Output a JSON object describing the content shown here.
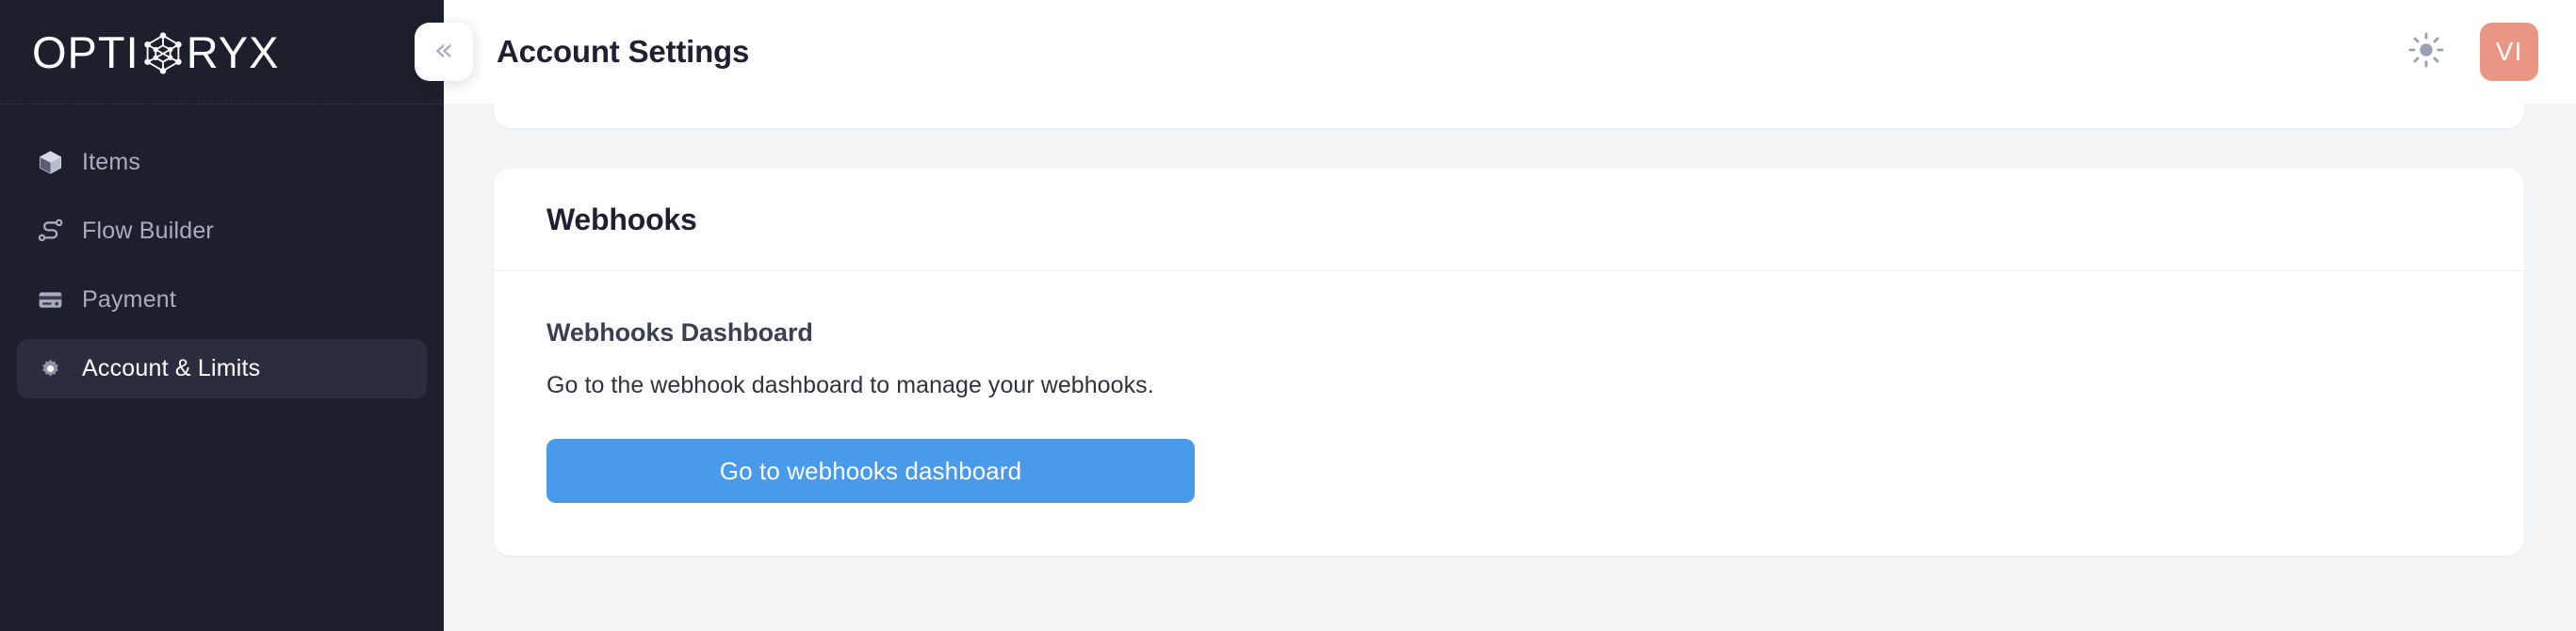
{
  "brand": {
    "text_before": "OPTI",
    "glyph_icon": "network-hexagon-icon",
    "text_after": "RYX",
    "full_name": "OPTIORYX"
  },
  "sidebar": {
    "background_color": "#1e1f2d",
    "active_item_color": "#2b2d3e",
    "items": [
      {
        "label": "Items",
        "icon": "cube-icon",
        "active": false
      },
      {
        "label": "Flow Builder",
        "icon": "workflow-icon",
        "active": false
      },
      {
        "label": "Payment",
        "icon": "credit-card-icon",
        "active": false
      },
      {
        "label": "Account & Limits",
        "icon": "gear-icon",
        "active": true
      }
    ]
  },
  "topbar": {
    "collapse_icon": "chevron-double-left-icon",
    "collapse_glyph": "«",
    "title": "Account Settings",
    "theme_toggle_icon": "sun-icon",
    "avatar_initials": "VI",
    "avatar_color": "#ea9685"
  },
  "content": {
    "card": {
      "title": "Webhooks",
      "section": {
        "title": "Webhooks Dashboard",
        "description": "Go to the webhook dashboard to manage your webhooks.",
        "button_label": "Go to webhooks dashboard",
        "button_color": "#4a9aeb"
      }
    }
  }
}
